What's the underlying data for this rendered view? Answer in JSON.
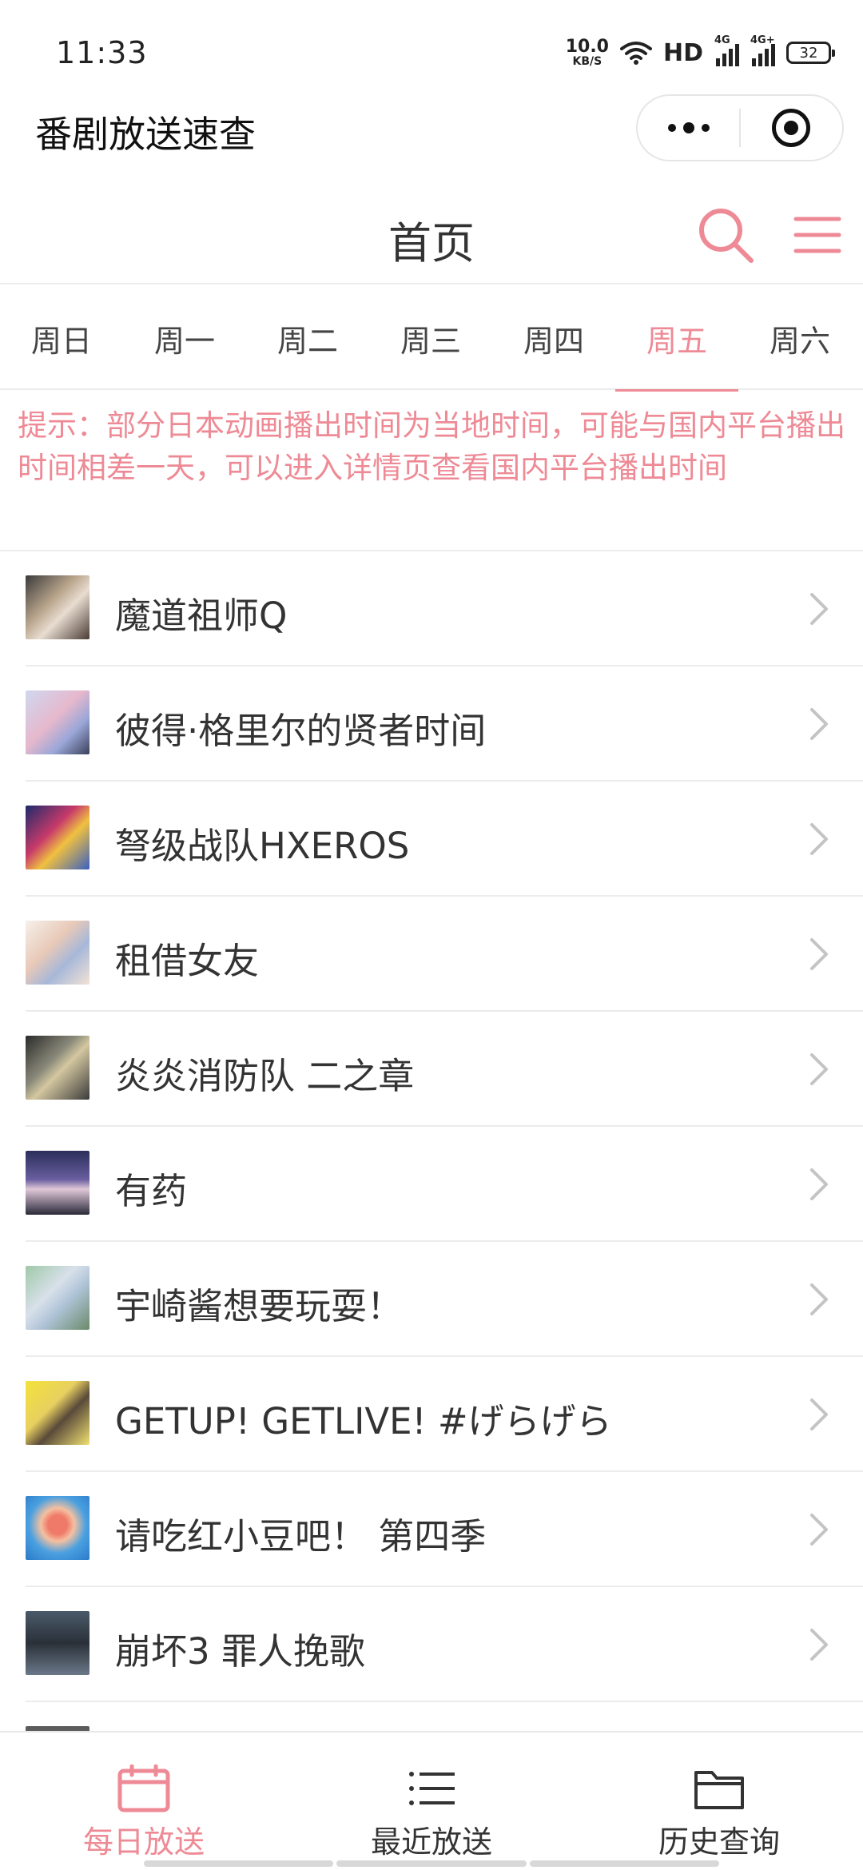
{
  "status_bar": {
    "time": "11:33",
    "net_speed_value": "10.0",
    "net_speed_unit": "KB/S",
    "hd": "HD",
    "signal1": "4G",
    "signal2": "4G+",
    "battery": "32"
  },
  "app_title": "番剧放送速查",
  "header": {
    "title": "首页"
  },
  "tabs": [
    {
      "label": "周日"
    },
    {
      "label": "周一"
    },
    {
      "label": "周二"
    },
    {
      "label": "周三"
    },
    {
      "label": "周四"
    },
    {
      "label": "周五",
      "active": true
    },
    {
      "label": "周六"
    }
  ],
  "notice": "提示：部分日本动画播出时间为当地时间，可能与国内平台播出时间相差一天，可以进入详情页查看国内平台播出时间",
  "list": [
    {
      "title": "魔道祖师Q"
    },
    {
      "title": "彼得·格里尔的贤者时间"
    },
    {
      "title": "弩级战队HXEROS"
    },
    {
      "title": "租借女友"
    },
    {
      "title": "炎炎消防队 二之章"
    },
    {
      "title": "有药"
    },
    {
      "title": "宇崎酱想要玩耍！"
    },
    {
      "title": "GETUP! GETLIVE! #げらげら"
    },
    {
      "title": "请吃红小豆吧！ 第四季"
    },
    {
      "title": "崩坏3 罪人挽歌"
    }
  ],
  "bottom_nav": [
    {
      "label": "每日放送",
      "icon": "calendar-icon",
      "active": true
    },
    {
      "label": "最近放送",
      "icon": "list-icon"
    },
    {
      "label": "历史查询",
      "icon": "folder-icon"
    }
  ],
  "colors": {
    "accent": "#ee8a95",
    "text": "#333333",
    "divider": "#ececec"
  }
}
